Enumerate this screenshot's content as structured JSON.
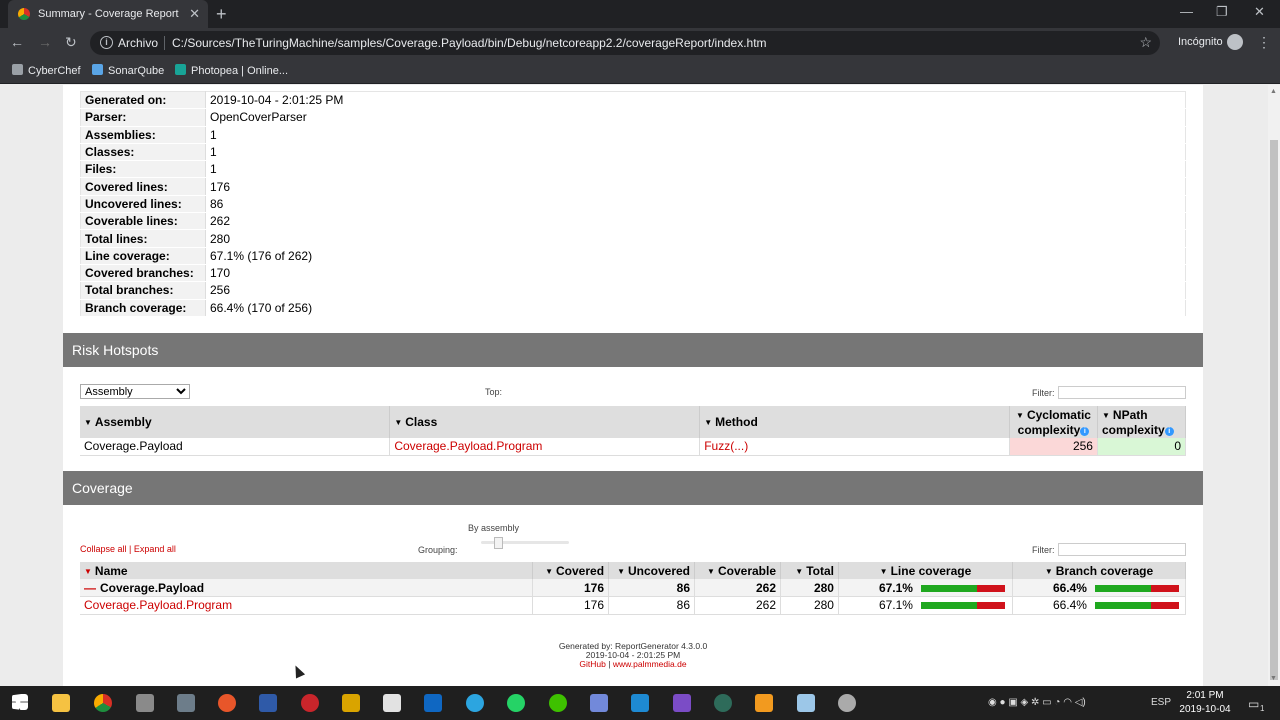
{
  "browser": {
    "tab_title": "Summary - Coverage Report",
    "tab_close": "✕",
    "new_tab": "+",
    "minimize": "—",
    "maximize": "❐",
    "close": "✕",
    "back": "←",
    "forward": "→",
    "reload": "↻",
    "info": "i",
    "archivo": "Archivo",
    "url": "C:/Sources/TheTuringMachine/samples/Coverage.Payload/bin/Debug/netcoreapp2.2/coverageReport/index.htm",
    "star": "☆",
    "incognito": "Incógnito",
    "menu": "⋮",
    "bookmarks": [
      {
        "label": "CyberChef",
        "color": "#9aa0a6"
      },
      {
        "label": "SonarQube",
        "color": "#5aa5e6"
      },
      {
        "label": "Photopea | Online...",
        "color": "#18a497"
      }
    ]
  },
  "summary": [
    {
      "label": "Generated on:",
      "value": "2019-10-04 - 2:01:25 PM"
    },
    {
      "label": "Parser:",
      "value": "OpenCoverParser"
    },
    {
      "label": "Assemblies:",
      "value": "1"
    },
    {
      "label": "Classes:",
      "value": "1"
    },
    {
      "label": "Files:",
      "value": "1"
    },
    {
      "label": "Covered lines:",
      "value": "176"
    },
    {
      "label": "Uncovered lines:",
      "value": "86"
    },
    {
      "label": "Coverable lines:",
      "value": "262"
    },
    {
      "label": "Total lines:",
      "value": "280"
    },
    {
      "label": "Line coverage:",
      "value": "67.1% (176 of 262)"
    },
    {
      "label": "Covered branches:",
      "value": "170"
    },
    {
      "label": "Total branches:",
      "value": "256"
    },
    {
      "label": "Branch coverage:",
      "value": "66.4% (170 of 256)"
    }
  ],
  "risk": {
    "title": "Risk Hotspots",
    "select_value": "Assembly",
    "select_arrow": "▼",
    "top_label": "Top:",
    "filter_label": "Filter:",
    "headers": {
      "assembly": "Assembly",
      "class": "Class",
      "method": "Method",
      "cyclomatic": "Cyclomatic complexity",
      "npath": "NPath complexity"
    },
    "sort_arrow": "▼",
    "info_glyph": "i",
    "rows": [
      {
        "assembly": "Coverage.Payload",
        "class": "Coverage.Payload.Program",
        "method": "Fuzz(...)",
        "cyclomatic": "256",
        "npath": "0"
      }
    ]
  },
  "coverage": {
    "title": "Coverage",
    "collapse_all": "Collapse all",
    "separator": "|",
    "expand_all": "Expand all",
    "grouping_label": "Grouping:",
    "by_assembly": "By assembly",
    "filter_label": "Filter:",
    "minus_glyph": "—",
    "headers": {
      "name": "Name",
      "covered": "Covered",
      "uncovered": "Uncovered",
      "coverable": "Coverable",
      "total": "Total",
      "line_coverage": "Line coverage",
      "branch_coverage": "Branch coverage"
    },
    "rows": [
      {
        "name": "Coverage.Payload",
        "covered": "176",
        "uncovered": "86",
        "coverable": "262",
        "total": "280",
        "line_coverage": "67.1%",
        "line_fraction": 0.671,
        "branch_coverage": "66.4%",
        "branch_fraction": 0.664,
        "group": true
      },
      {
        "name": "Coverage.Payload.Program",
        "covered": "176",
        "uncovered": "86",
        "coverable": "262",
        "total": "280",
        "line_coverage": "67.1%",
        "line_fraction": 0.671,
        "branch_coverage": "66.4%",
        "branch_fraction": 0.664,
        "group": false
      }
    ]
  },
  "footer": {
    "generated_by": "Generated by: ReportGenerator 4.3.0.0",
    "date": "2019-10-04 - 2:01:25 PM",
    "github": "GitHub",
    "separator": "|",
    "site": "www.palmmedia.de"
  },
  "taskbar": {
    "lang": "ESP",
    "time": "2:01 PM",
    "date": "2019-10-04",
    "notification_count": "1"
  },
  "colors": {
    "accent_red": "#cc0000",
    "coverage_green": "#1fa81f",
    "coverage_red": "#d0121b",
    "section_header": "#767676"
  }
}
